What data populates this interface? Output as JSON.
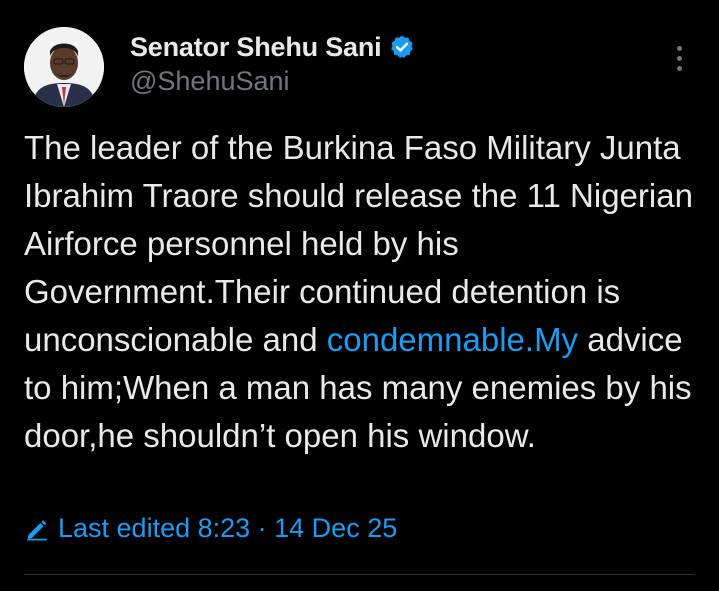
{
  "author": {
    "display_name": "Senator Shehu Sani",
    "handle": "@ShehuSani",
    "verified_icon": "verified-badge-icon",
    "verified_color": "#1d9bf0"
  },
  "tweet": {
    "text_before_link": "The leader of the Burkina Faso Military Junta Ibrahim Traore should release the 11 Nigerian Airforce personnel held by his Government.Their continued detention is unconscionable and ",
    "link_text": "condemnable.My",
    "text_after_link": " advice to him;When a man has many enemies by his door,he shouldn’t open his window."
  },
  "meta": {
    "edited_label": "Last edited 8:23 · 14 Dec 25",
    "edit_icon": "pencil-icon"
  },
  "colors": {
    "background": "#000000",
    "text": "#e7e9ea",
    "secondary": "#71767b",
    "accent": "#1d9bf0"
  }
}
